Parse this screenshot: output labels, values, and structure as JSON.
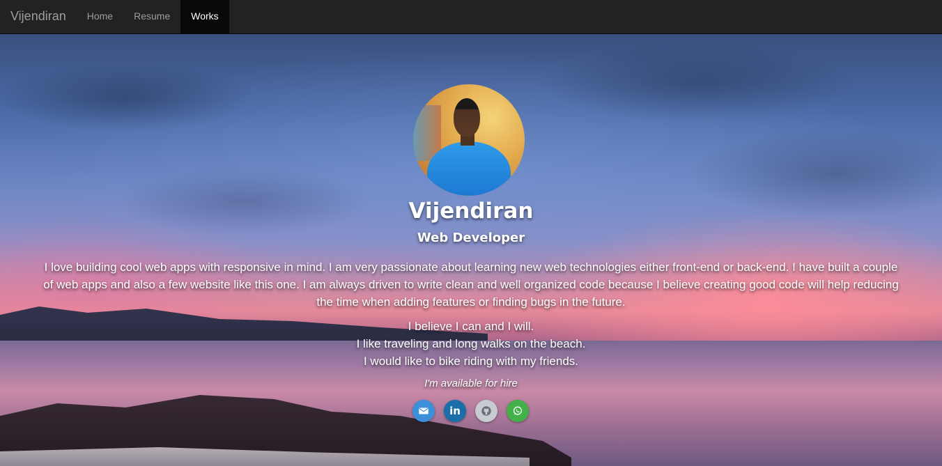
{
  "navbar": {
    "brand": "Vijendiran",
    "items": [
      {
        "label": "Home",
        "active": false
      },
      {
        "label": "Resume",
        "active": false
      },
      {
        "label": "Works",
        "active": true
      }
    ]
  },
  "profile": {
    "name": "Vijendiran",
    "title": "Web Developer",
    "bio": "I love building cool web apps with responsive in mind. I am very passionate about learning new web technologies either front-end or back-end. I have built a couple of web apps and also a few website like this one. I am always driven to write clean and well organized code because I believe creating good code will help reducing the time when adding features or finding bugs in the future.",
    "beliefs": [
      "I believe I can and I will.",
      "I like traveling and long walks on the beach.",
      "I would like to bike riding with my friends."
    ],
    "availability": "I'm available for hire"
  },
  "social": [
    {
      "name": "email",
      "icon": "envelope-icon",
      "color": "#3c8fd8"
    },
    {
      "name": "linkedin",
      "icon": "linkedin-icon",
      "color": "#1b6fa8",
      "text": "in"
    },
    {
      "name": "github",
      "icon": "github-icon",
      "color": "#c8cbd2"
    },
    {
      "name": "whatsapp",
      "icon": "whatsapp-icon",
      "color": "#43b049"
    }
  ]
}
